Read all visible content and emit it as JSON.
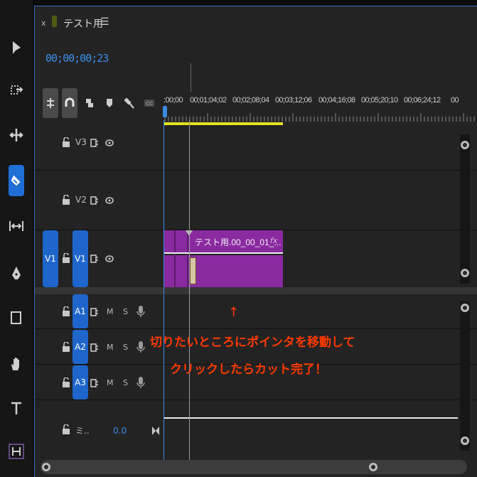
{
  "tools": [
    {
      "name": "selection-tool",
      "icon": "arrow-icon"
    },
    {
      "name": "track-select-tool",
      "icon": "track-select-icon"
    },
    {
      "name": "ripple-edit-tool",
      "icon": "ripple-icon"
    },
    {
      "name": "razor-tool",
      "icon": "razor-icon",
      "active": true
    },
    {
      "name": "slip-tool",
      "icon": "slip-icon"
    },
    {
      "name": "pen-tool",
      "icon": "pen-icon"
    },
    {
      "name": "rectangle-tool",
      "icon": "rectangle-icon"
    },
    {
      "name": "hand-tool",
      "icon": "hand-icon"
    },
    {
      "name": "type-tool",
      "icon": "type-icon"
    },
    {
      "name": "extra-tool",
      "icon": "extra-icon"
    }
  ],
  "tab": {
    "close": "x",
    "title": "テスト用",
    "menu": "☰"
  },
  "timecode": "00;00;00;23",
  "ruler": {
    "labels": [
      ":00;00",
      "00;01;04;02",
      "00;02;08;04",
      "00;03;12;06",
      "00;04;16;08",
      "00;05;20;10",
      "00;06;24;12",
      "00"
    ]
  },
  "video_tracks": [
    {
      "name": "V3",
      "source": ""
    },
    {
      "name": "V2",
      "source": ""
    },
    {
      "name": "V1",
      "source": "V1"
    }
  ],
  "audio_tracks": [
    {
      "name": "A1",
      "m": "M",
      "s": "S"
    },
    {
      "name": "A2",
      "m": "M",
      "s": "S"
    },
    {
      "name": "A3",
      "m": "M",
      "s": "S"
    }
  ],
  "master": {
    "label": "ミ..",
    "value": "0.0"
  },
  "clip": {
    "name": "テスト用.00_00_01_...",
    "fx": "fx",
    "color": "#8a2aa0"
  },
  "annotation": {
    "arrow": "↑",
    "line1": "切りたいところにポインタを移動して",
    "line2": "クリックしたらカット完了！"
  },
  "colors": {
    "accent": "#1f66cc",
    "timecode": "#3c8fe8",
    "work_area": "#e7e01f",
    "annotation": "#ff3a00"
  }
}
